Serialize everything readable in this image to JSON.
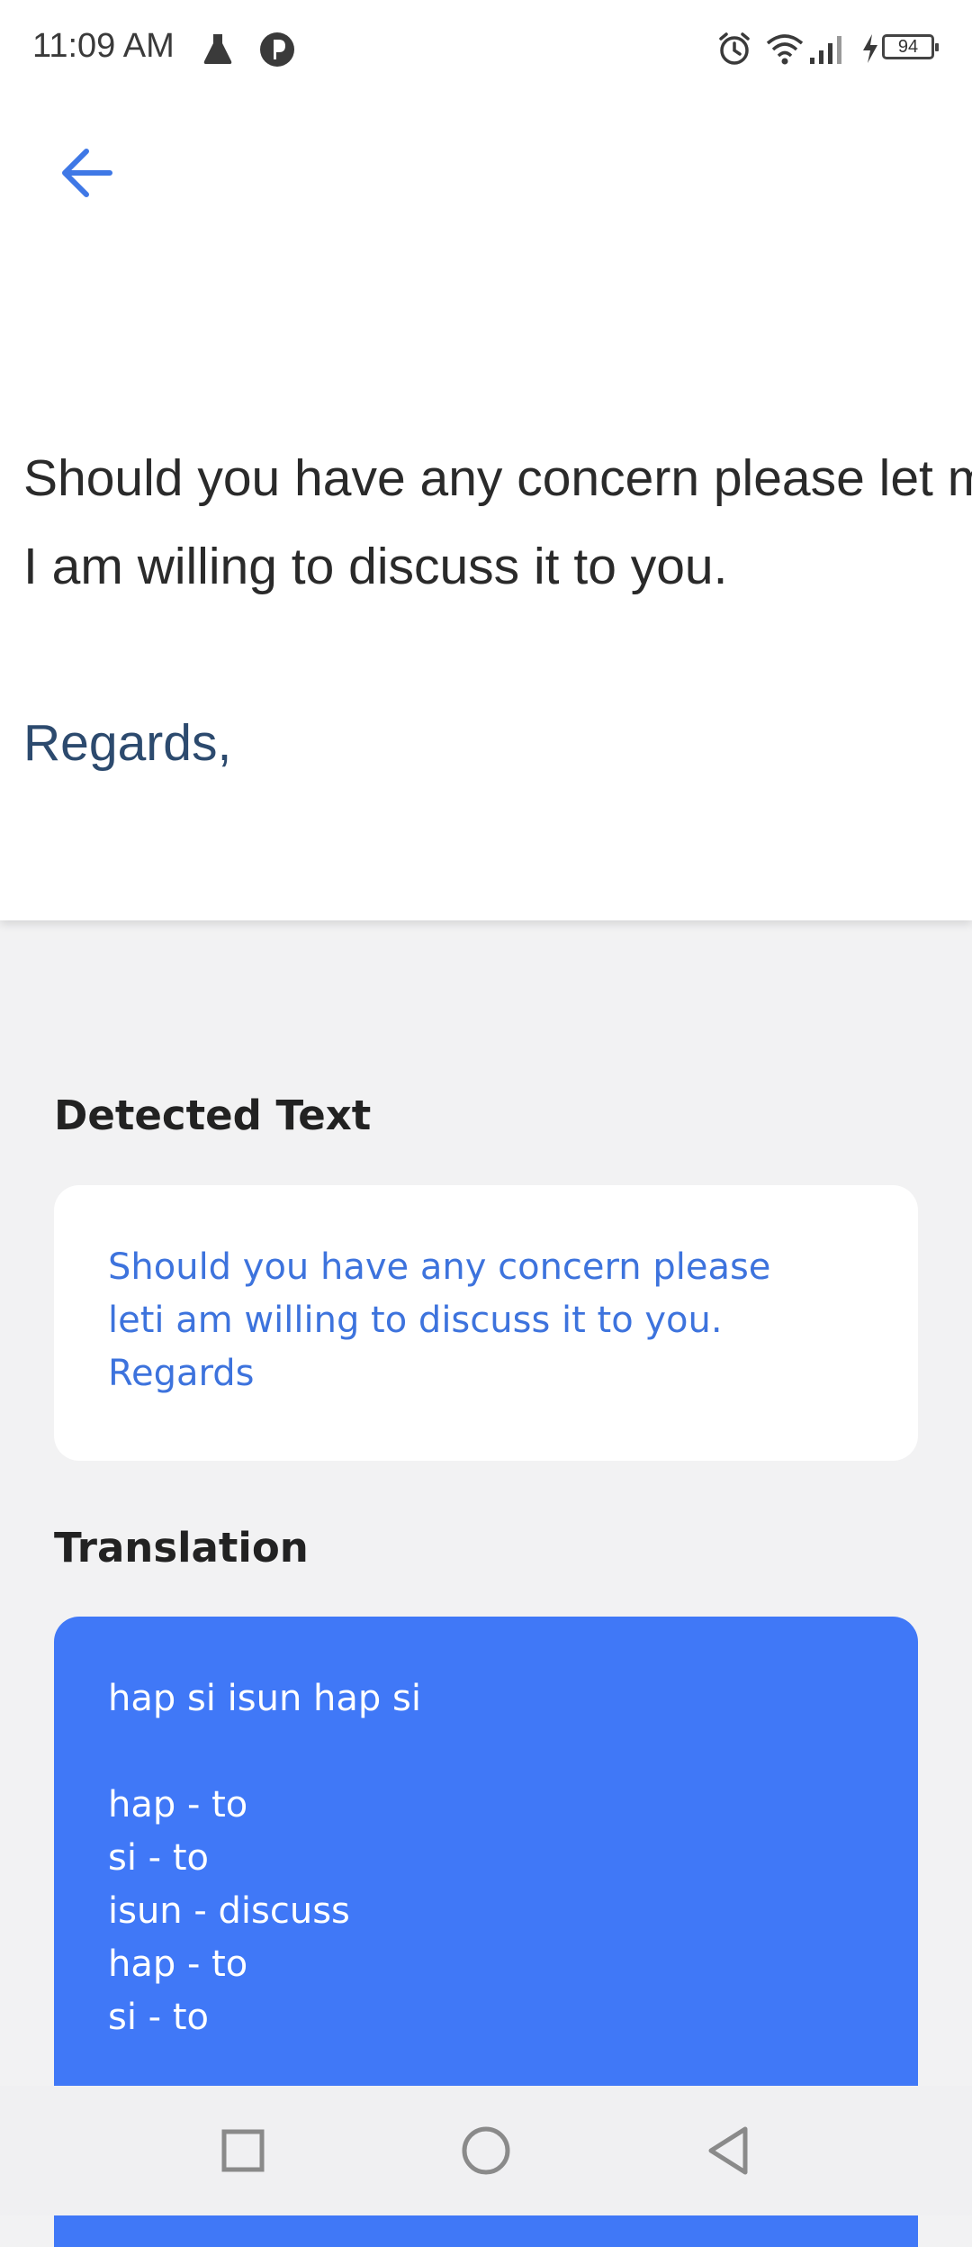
{
  "status_bar": {
    "time": "11:09 AM",
    "battery": "94",
    "icons": [
      "flask-icon",
      "app-p-icon",
      "alarm-icon",
      "wifi-icon",
      "signal-icon",
      "charging-icon",
      "battery-icon"
    ]
  },
  "image_preview": {
    "line1": "Should you have any concern please let m",
    "line2": "I am willing to discuss it to you.",
    "regards": "Regards,"
  },
  "detected": {
    "heading": "Detected Text",
    "text": "Should you have any concern please\nleti am willing to discuss it to you.\nRegards"
  },
  "translation": {
    "heading": "Translation",
    "text": "hap si isun hap si\n\nhap - to\nsi - to\nisun - discuss\nhap - to\nsi - to"
  },
  "colors": {
    "accent": "#4078f7",
    "detected_text": "#3d73dd",
    "background": "#f2f2f3"
  },
  "nav": [
    "recents-square-icon",
    "home-circle-icon",
    "back-triangle-icon"
  ]
}
